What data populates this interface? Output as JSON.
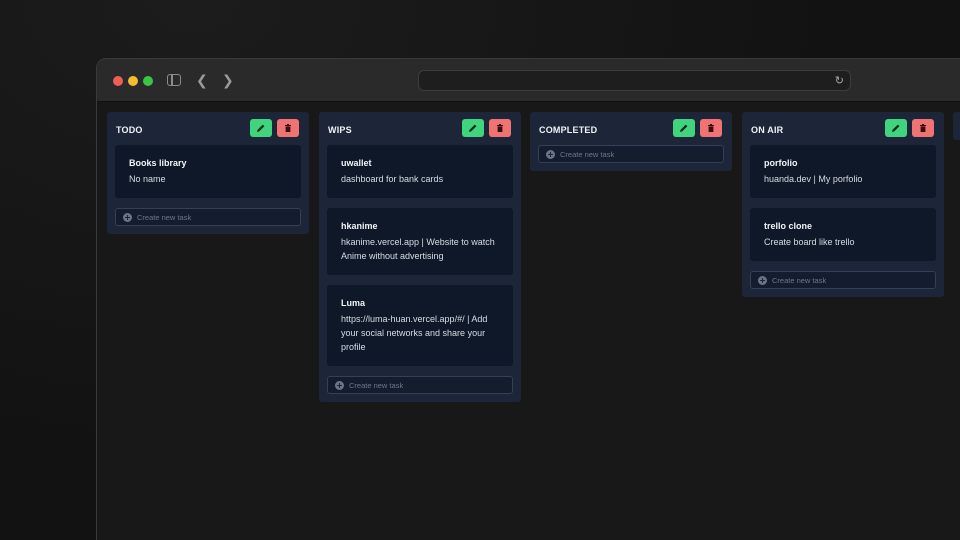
{
  "colors": {
    "edit": "#3fd47d",
    "delete": "#f07373",
    "column": "#1c2638",
    "card": "#0f1828"
  },
  "browser": {
    "url": "",
    "reload_icon": "reload-icon"
  },
  "columns": [
    {
      "title": "TODO",
      "cards": [
        {
          "title": "Books library",
          "desc": "No name"
        }
      ],
      "new_task": "Create new task"
    },
    {
      "title": "WIPS",
      "cards": [
        {
          "title": "uwallet",
          "desc": "dashboard for bank cards"
        },
        {
          "title": "hkanime",
          "desc": "hkanime.vercel.app | Website to watch Anime without advertising"
        },
        {
          "title": "Luma",
          "desc": "https://luma-huan.vercel.app/#/ | Add your social networks and share your profile"
        }
      ],
      "new_task": "Create new task"
    },
    {
      "title": "COMPLETED",
      "cards": [],
      "new_task": "Create new task"
    },
    {
      "title": "ON AIR",
      "cards": [
        {
          "title": "porfolio",
          "desc": "huanda.dev | My porfolio"
        },
        {
          "title": "trello clone",
          "desc": "Create board like trello"
        }
      ],
      "new_task": "Create new task"
    }
  ]
}
